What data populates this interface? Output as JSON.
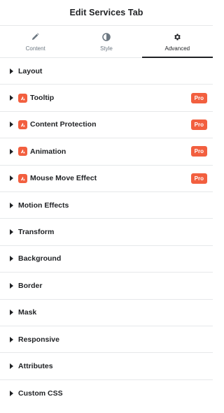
{
  "header": {
    "title": "Edit Services Tab"
  },
  "tabs": [
    {
      "label": "Content",
      "icon": "pencil-icon",
      "active": false
    },
    {
      "label": "Style",
      "icon": "half-circle-icon",
      "active": false
    },
    {
      "label": "Advanced",
      "icon": "gear-icon",
      "active": true
    }
  ],
  "sections": [
    {
      "title": "Layout",
      "pro": false
    },
    {
      "title": "Tooltip",
      "pro": true
    },
    {
      "title": "Content Protection",
      "pro": true
    },
    {
      "title": "Animation",
      "pro": true
    },
    {
      "title": "Mouse Move Effect",
      "pro": true
    },
    {
      "title": "Motion Effects",
      "pro": false
    },
    {
      "title": "Transform",
      "pro": false
    },
    {
      "title": "Background",
      "pro": false
    },
    {
      "title": "Border",
      "pro": false
    },
    {
      "title": "Mask",
      "pro": false
    },
    {
      "title": "Responsive",
      "pro": false
    },
    {
      "title": "Attributes",
      "pro": false
    },
    {
      "title": "Custom CSS",
      "pro": false
    }
  ],
  "pro_badge_label": "Pro",
  "colors": {
    "pro_accent": "#f25f3f",
    "text": "#1f2124",
    "muted": "#6d7882",
    "divider": "#e6e8ea"
  }
}
